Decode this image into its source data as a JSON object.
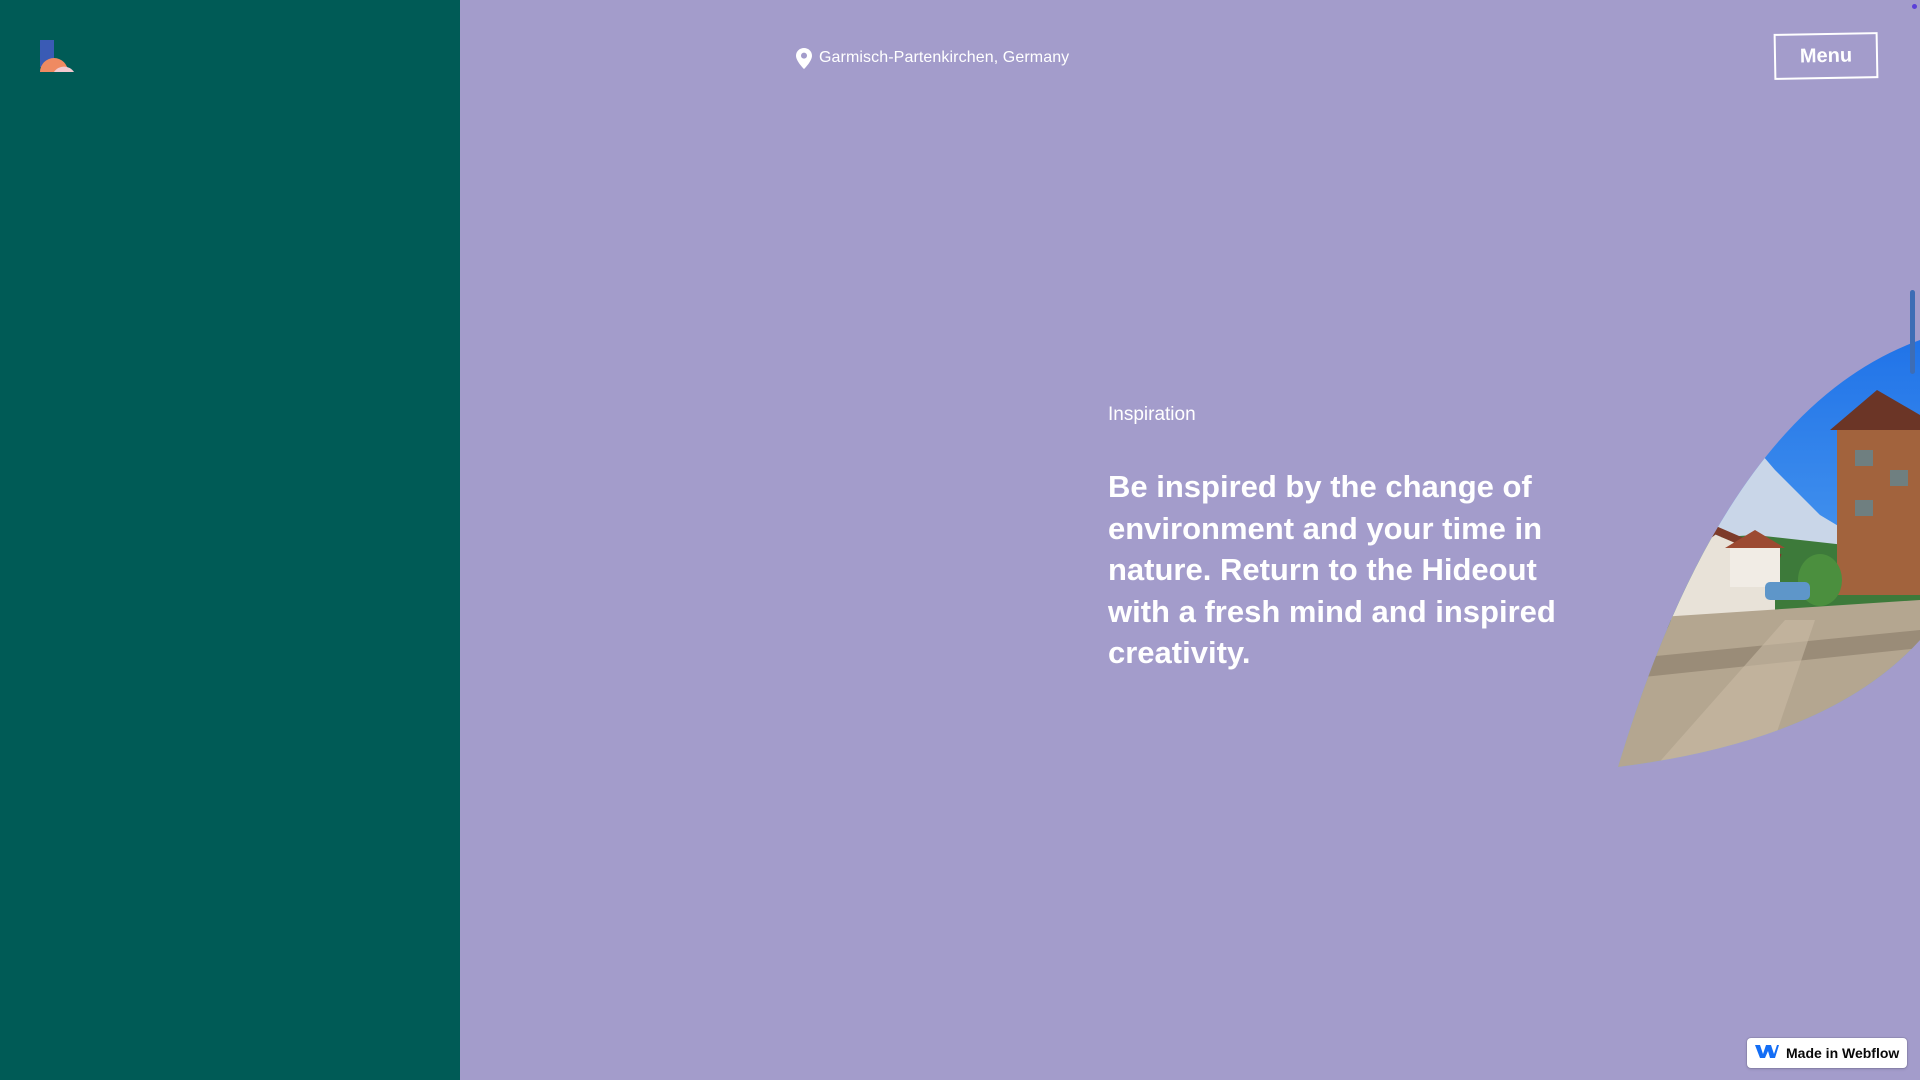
{
  "colors": {
    "left_panel_bg": "#005b56",
    "right_panel_bg": "#a39ccb",
    "text": "#ffffff",
    "webflow_blue": "#146ef5"
  },
  "header": {
    "logo_icon": "hideout-logo-icon",
    "location_icon": "map-pin-icon",
    "location_text": "Garmisch-Partenkirchen, Germany",
    "menu_label": "Menu"
  },
  "content": {
    "eyebrow": "Inspiration",
    "headline": "Be inspired by the change of environment and your time in nature. Return to the Hideout with a fresh mind and inspired creativity."
  },
  "badge": {
    "icon": "webflow-logo-icon",
    "label": "Made in Webflow"
  }
}
